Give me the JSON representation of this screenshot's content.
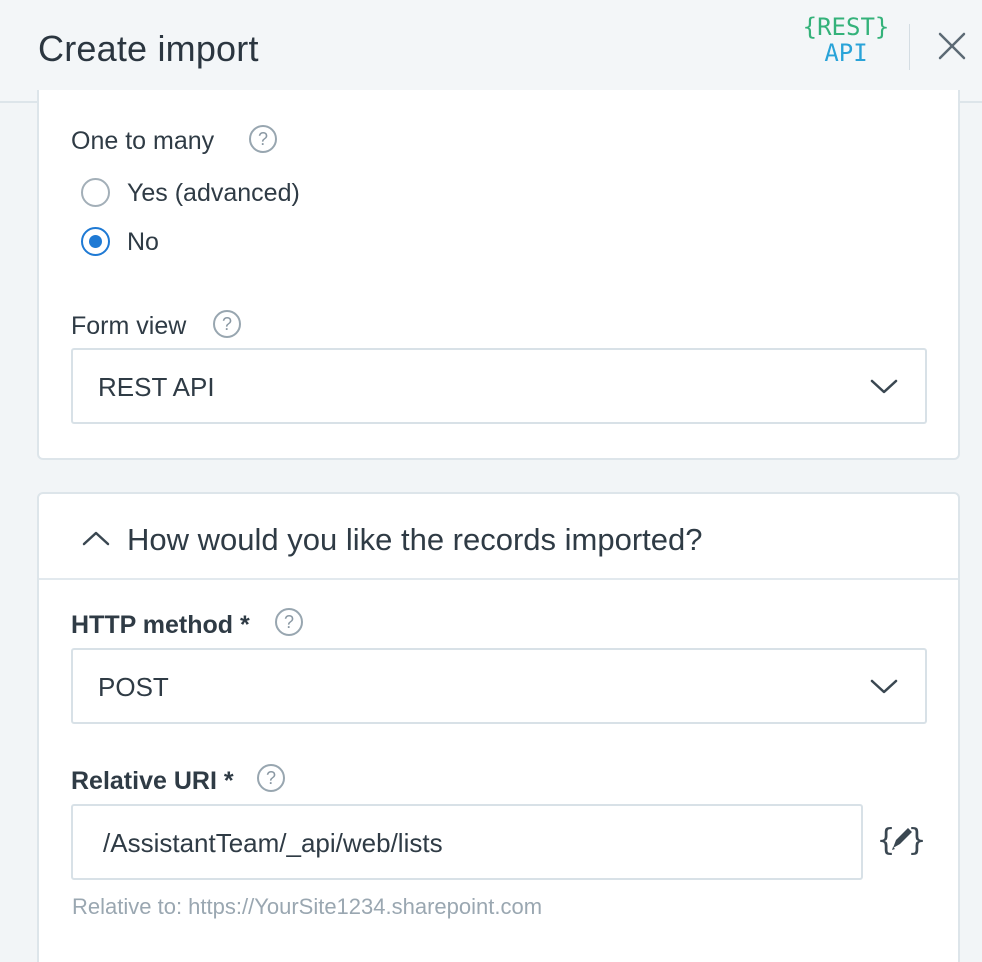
{
  "header": {
    "title": "Create import",
    "logo_line1": "{REST}",
    "logo_line2": "API"
  },
  "one_to_many": {
    "label": "One to many",
    "options": [
      {
        "label": "Yes (advanced)",
        "checked": false
      },
      {
        "label": "No",
        "checked": true
      }
    ]
  },
  "form_view": {
    "label": "Form view",
    "value": "REST API"
  },
  "records_section": {
    "title": "How would you like the records imported?",
    "http_method": {
      "label": "HTTP method *",
      "value": "POST"
    },
    "relative_uri": {
      "label": "Relative URI *",
      "value": "/AssistantTeam/_api/web/lists",
      "hint": "Relative to: https://YourSite1234.sharepoint.com"
    }
  },
  "colors": {
    "accent": "#1f7ad4",
    "logo_green": "#34b27a",
    "logo_blue": "#29a3d8"
  }
}
